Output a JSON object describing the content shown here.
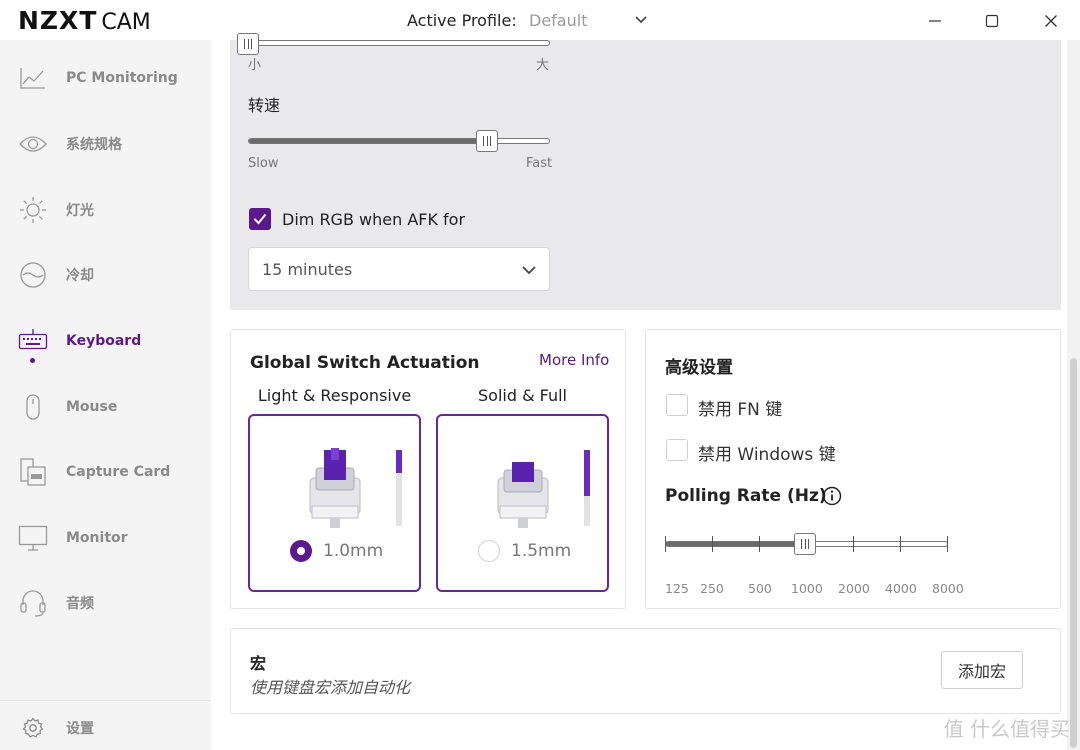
{
  "titlebar": {
    "brand": "NZXT",
    "app": "CAM",
    "profile_label": "Active Profile:",
    "profile_value": "Default"
  },
  "sidebar": {
    "items": [
      {
        "label": "PC Monitoring",
        "icon": "chart-line-icon",
        "active": false
      },
      {
        "label": "系统规格",
        "icon": "eye-icon",
        "active": false
      },
      {
        "label": "灯光",
        "icon": "sun-icon",
        "active": false
      },
      {
        "label": "冷却",
        "icon": "cooling-icon",
        "active": false
      },
      {
        "label": "Keyboard",
        "icon": "keyboard-icon",
        "active": true
      },
      {
        "label": "Mouse",
        "icon": "mouse-icon",
        "active": false
      },
      {
        "label": "Capture Card",
        "icon": "capture-card-icon",
        "active": false
      },
      {
        "label": "Monitor",
        "icon": "monitor-icon",
        "active": false
      },
      {
        "label": "音频",
        "icon": "headset-icon",
        "active": false
      }
    ],
    "settings_label": "设置"
  },
  "lighting": {
    "size_min": "小",
    "size_max": "大",
    "size_value": 0,
    "speed_label": "转速",
    "speed_min": "Slow",
    "speed_max": "Fast",
    "speed_value": 0.8,
    "dim_label": "Dim RGB when AFK for",
    "dim_checked": true,
    "afk_value": "15 minutes"
  },
  "actuation": {
    "title": "Global Switch Actuation",
    "more_info": "More Info",
    "options": [
      {
        "caption": "Light & Responsive",
        "value": "1.0mm",
        "selected": true,
        "depth": 0.3
      },
      {
        "caption": "Solid & Full",
        "value": "1.5mm",
        "selected": false,
        "depth": 0.6
      }
    ]
  },
  "advanced": {
    "title": "高级设置",
    "disable_fn": "禁用 FN 键",
    "disable_windows": "禁用 Windows 键",
    "polling_title": "Polling Rate (Hz)",
    "polling_rates": [
      "125",
      "250",
      "500",
      "1000",
      "2000",
      "4000",
      "8000"
    ],
    "polling_selected": "1000"
  },
  "macro": {
    "title": "宏",
    "subtitle": "使用键盘宏添加自动化",
    "button": "添加宏"
  },
  "watermark": "值 什么值得买",
  "colors": {
    "accent": "#5b1a8c",
    "panel": "#e9e9eb"
  }
}
